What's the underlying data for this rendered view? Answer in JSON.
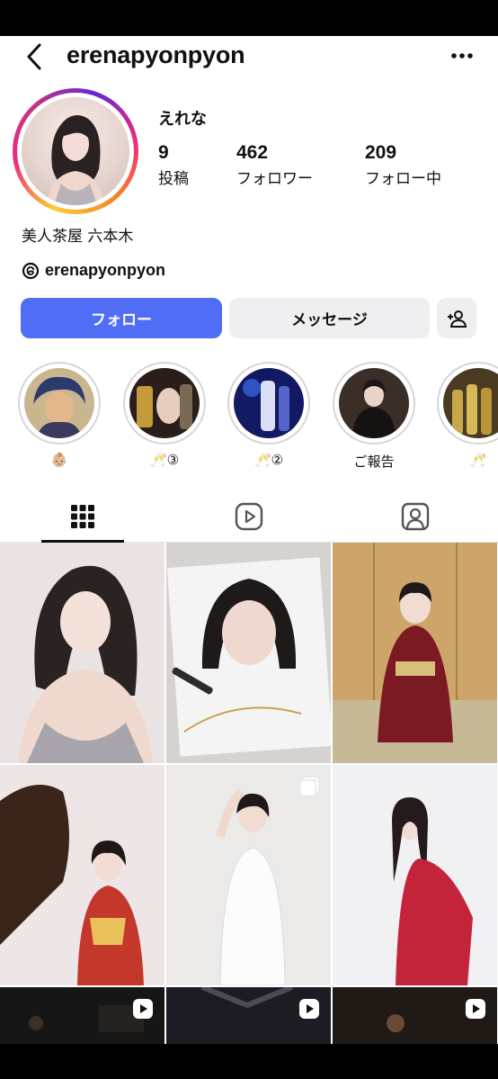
{
  "header": {
    "username": "erenapyonpyon",
    "back_icon": "back-chevron-icon",
    "more_icon": "more-dots-icon"
  },
  "profile": {
    "display_name": "えれな",
    "stats": [
      {
        "num": "9",
        "label": "投稿"
      },
      {
        "num": "462",
        "label": "フォロワー"
      },
      {
        "num": "209",
        "label": "フォロー中"
      }
    ],
    "bio": "美人茶屋 六本木",
    "threads_handle": "erenapyonpyon"
  },
  "actions": {
    "follow": "フォロー",
    "message": "メッセージ",
    "follow_color": "#4f6df5"
  },
  "highlights": [
    {
      "label": "👶🏼"
    },
    {
      "label": "🥂③"
    },
    {
      "label": "🥂②"
    },
    {
      "label": "ご報告"
    },
    {
      "label": "🥂"
    }
  ],
  "tabs": [
    "grid-icon",
    "reels-icon",
    "tagged-icon"
  ],
  "posts_count_rows": 3
}
